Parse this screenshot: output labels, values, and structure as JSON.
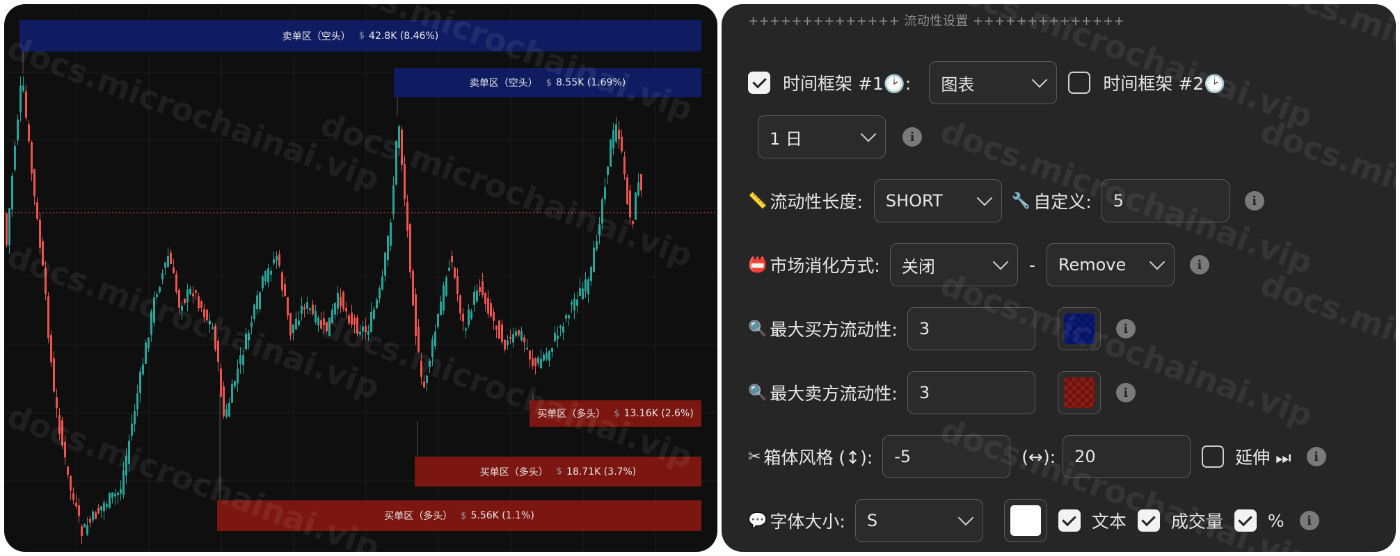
{
  "watermark": "docs.microchainai.vip",
  "chart": {
    "zones": [
      {
        "label": "卖单区（空头）",
        "dollar": "$",
        "value": "42.8K (8.46%)",
        "kind": "sell"
      },
      {
        "label": "卖单区（空头）",
        "dollar": "$",
        "value": "8.55K (1.69%)",
        "kind": "sell"
      },
      {
        "label": "买单区（多头）",
        "dollar": "$",
        "value": "13.16K (2.6%)",
        "kind": "buy"
      },
      {
        "label": "买单区（多头）",
        "dollar": "$",
        "value": "18.71K (3.7%)",
        "kind": "buy"
      },
      {
        "label": "买单区（多头）",
        "dollar": "$",
        "value": "5.56K (1.1%)",
        "kind": "buy"
      }
    ],
    "colors": {
      "up": "#26a69a",
      "down": "#ef5350",
      "sell_zone": "#0f1c62",
      "buy_zone": "#7c1610",
      "price_line": "#d8443c"
    }
  },
  "settings": {
    "title": "++++++++++++++ 流动性设置 ++++++++++++++",
    "timeframe1": {
      "label": "时间框架 #1🕑:",
      "checked": true,
      "value": "图表"
    },
    "timeframe2": {
      "label": "时间框架 #2🕑",
      "checked": false,
      "value": "1 日"
    },
    "liquidity_length": {
      "label": "流动性长度:",
      "icon": "📏",
      "value": "SHORT",
      "custom_label": "自定义:",
      "custom_icon": "🔧",
      "custom_value": "5"
    },
    "mitigation": {
      "label": "市场消化方式:",
      "icon": "📛",
      "value": "关闭",
      "sep": "-",
      "value2": "Remove"
    },
    "max_buy": {
      "label": "最大买方流动性:",
      "icon": "🔍",
      "value": "3",
      "color": "#0a1a7a"
    },
    "max_sell": {
      "label": "最大卖方流动性:",
      "icon": "🔍",
      "value": "3",
      "color": "#8a1c14"
    },
    "box_style": {
      "label": "箱体风格 (↕):",
      "icon": "✂",
      "value": "-5",
      "h_label": "(↔):",
      "h_value": "20",
      "extend_label": "延伸 ⏭",
      "extend_checked": false
    },
    "font_size": {
      "label": "字体大小:",
      "icon": "💬",
      "value": "S",
      "color": "#ffffff",
      "text_label": "文本",
      "text_checked": true,
      "volume_label": "成交量",
      "volume_checked": true,
      "pct_label": "%",
      "pct_checked": true
    }
  },
  "info_glyph": "i"
}
